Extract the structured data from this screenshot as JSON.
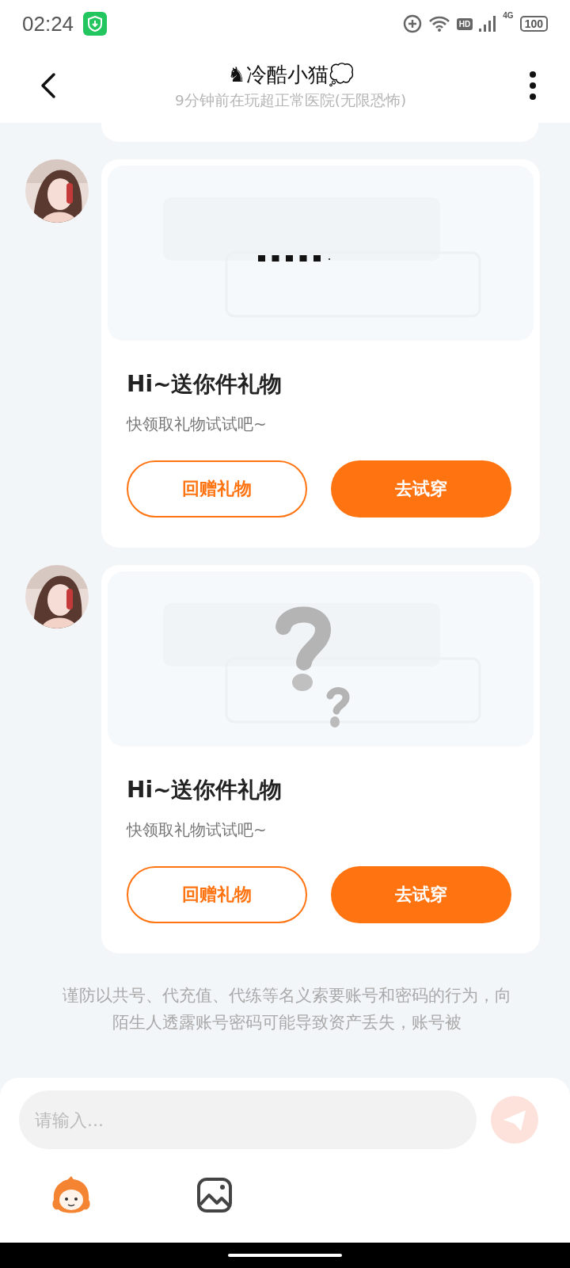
{
  "status_bar": {
    "time": "02:24",
    "battery": "100",
    "network": "4G",
    "hd": "HD"
  },
  "header": {
    "title": "♞冷酷小猫💭",
    "subtitle": "9分钟前在玩超正常医院(无限恐怖)"
  },
  "messages": [
    {
      "kind": "loading",
      "title": "Hi~送你件礼物",
      "text": "快领取礼物试试吧~",
      "buttons": [
        {
          "label": "回赠礼物",
          "kind": "outline"
        },
        {
          "label": "去试穿",
          "kind": "filled"
        }
      ]
    },
    {
      "kind": "unknown",
      "title": "Hi~送你件礼物",
      "text": "快领取礼物试试吧~",
      "buttons": [
        {
          "label": "回赠礼物",
          "kind": "outline"
        },
        {
          "label": "去试穿",
          "kind": "filled"
        }
      ]
    }
  ],
  "notice": "谨防以共号、代充值、代练等名义索要账号和密码的行为，向陌生人透露账号密码可能导致资产丢失，账号被",
  "input": {
    "placeholder": "请输入..."
  }
}
